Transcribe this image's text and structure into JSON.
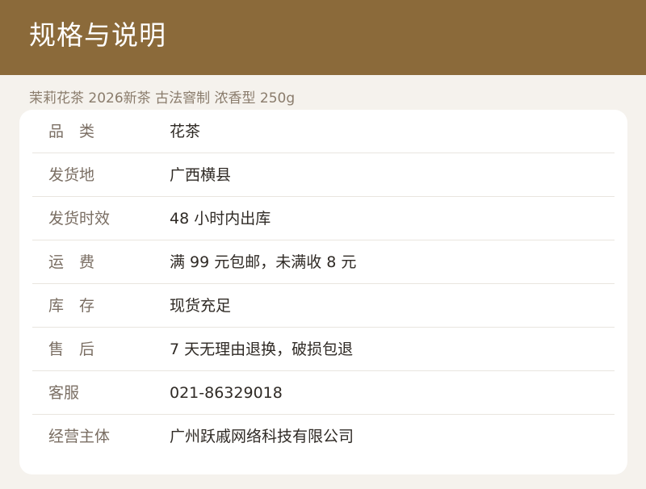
{
  "header": {
    "title": "规格与说明"
  },
  "subtitle": "茉莉花茶 2026新茶 古法窨制 浓香型 250g",
  "specs": [
    {
      "label": "品　类",
      "value": "花茶"
    },
    {
      "label": "发货地",
      "value": "广西横县"
    },
    {
      "label": "发货时效",
      "value": "48 小时内出库"
    },
    {
      "label": "运　费",
      "value": "满 99 元包邮，未满收 8 元"
    },
    {
      "label": "库　存",
      "value": "现货充足"
    },
    {
      "label": "售　后",
      "value": "7 天无理由退换，破损包退"
    },
    {
      "label": "客服",
      "value": "021-86329018"
    },
    {
      "label": "经营主体",
      "value": "广州跃戚网络科技有限公司"
    }
  ],
  "colors": {
    "header_bg": "#8b6a3a",
    "page_bg": "#f5f2ed",
    "card_bg": "#ffffff"
  }
}
